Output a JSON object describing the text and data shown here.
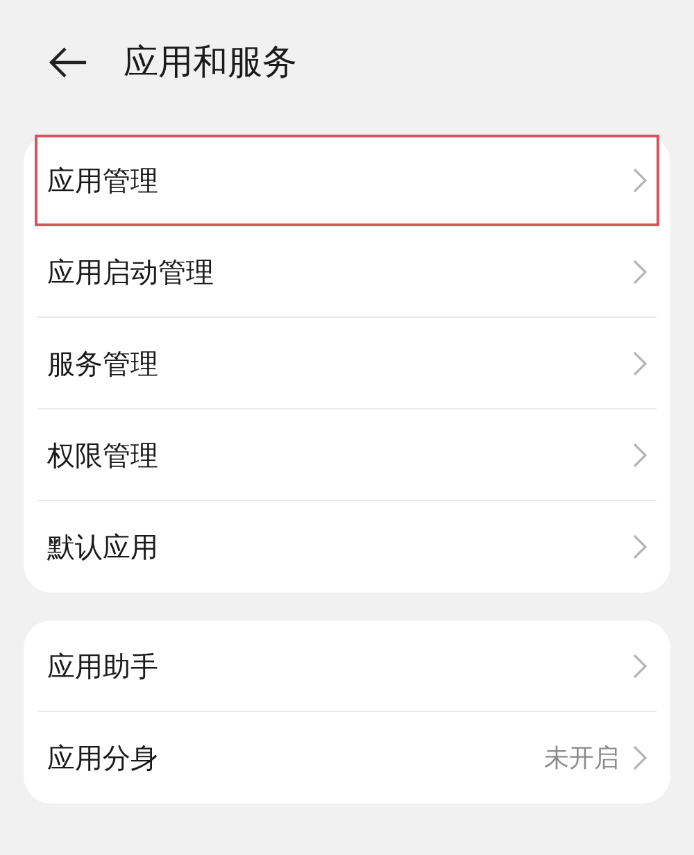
{
  "header": {
    "title": "应用和服务"
  },
  "groups": [
    {
      "items": [
        {
          "label": "应用管理",
          "highlighted": true
        },
        {
          "label": "应用启动管理",
          "highlighted": false
        },
        {
          "label": "服务管理",
          "highlighted": false
        },
        {
          "label": "权限管理",
          "highlighted": false
        },
        {
          "label": "默认应用",
          "highlighted": false
        }
      ]
    },
    {
      "items": [
        {
          "label": "应用助手",
          "highlighted": false
        },
        {
          "label": "应用分身",
          "value": "未开启",
          "highlighted": false
        }
      ]
    }
  ]
}
